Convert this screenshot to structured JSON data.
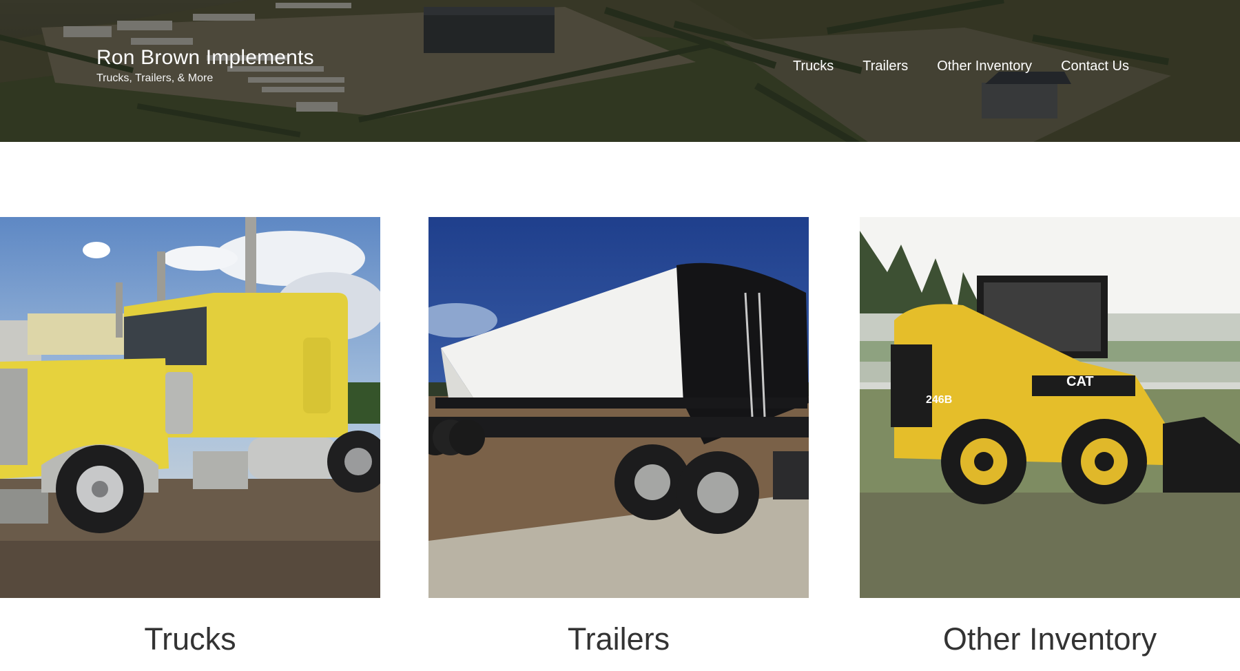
{
  "header": {
    "site_title": "Ron Brown Implements",
    "tagline": "Trucks, Trailers, & More"
  },
  "nav": {
    "items": [
      {
        "label": "Trucks"
      },
      {
        "label": "Trailers"
      },
      {
        "label": "Other Inventory"
      },
      {
        "label": "Contact Us"
      }
    ]
  },
  "cards": [
    {
      "title": "Trucks",
      "image": "yellow-semi-truck-photo"
    },
    {
      "title": "Trailers",
      "image": "grain-hopper-trailer-photo"
    },
    {
      "title": "Other Inventory",
      "image": "cat-skid-steer-photo"
    }
  ],
  "equipment_labels": {
    "skid_steer_brand": "CAT",
    "skid_steer_model": "246B"
  },
  "colors": {
    "link_text": "#ffffff",
    "caption_text": "#333333",
    "truck_yellow": "#e3cf3c",
    "cat_yellow": "#e5be2a"
  }
}
